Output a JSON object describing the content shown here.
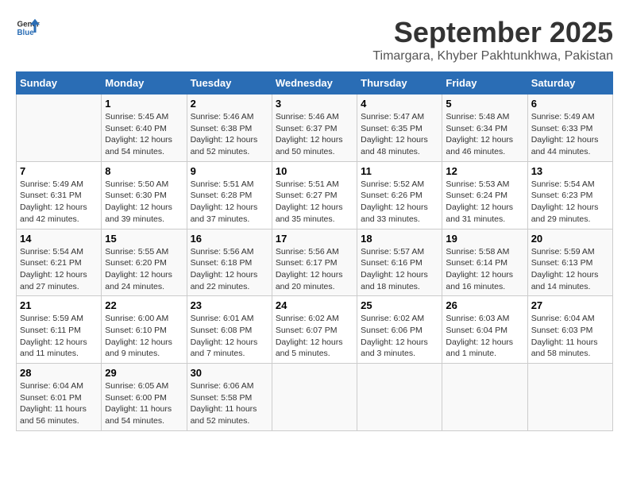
{
  "header": {
    "logo_general": "General",
    "logo_blue": "Blue",
    "month_title": "September 2025",
    "subtitle": "Timargara, Khyber Pakhtunkhwa, Pakistan"
  },
  "days_of_week": [
    "Sunday",
    "Monday",
    "Tuesday",
    "Wednesday",
    "Thursday",
    "Friday",
    "Saturday"
  ],
  "weeks": [
    [
      {
        "day": "",
        "sunrise": "",
        "sunset": "",
        "daylight": ""
      },
      {
        "day": "1",
        "sunrise": "Sunrise: 5:45 AM",
        "sunset": "Sunset: 6:40 PM",
        "daylight": "Daylight: 12 hours and 54 minutes."
      },
      {
        "day": "2",
        "sunrise": "Sunrise: 5:46 AM",
        "sunset": "Sunset: 6:38 PM",
        "daylight": "Daylight: 12 hours and 52 minutes."
      },
      {
        "day": "3",
        "sunrise": "Sunrise: 5:46 AM",
        "sunset": "Sunset: 6:37 PM",
        "daylight": "Daylight: 12 hours and 50 minutes."
      },
      {
        "day": "4",
        "sunrise": "Sunrise: 5:47 AM",
        "sunset": "Sunset: 6:35 PM",
        "daylight": "Daylight: 12 hours and 48 minutes."
      },
      {
        "day": "5",
        "sunrise": "Sunrise: 5:48 AM",
        "sunset": "Sunset: 6:34 PM",
        "daylight": "Daylight: 12 hours and 46 minutes."
      },
      {
        "day": "6",
        "sunrise": "Sunrise: 5:49 AM",
        "sunset": "Sunset: 6:33 PM",
        "daylight": "Daylight: 12 hours and 44 minutes."
      }
    ],
    [
      {
        "day": "7",
        "sunrise": "Sunrise: 5:49 AM",
        "sunset": "Sunset: 6:31 PM",
        "daylight": "Daylight: 12 hours and 42 minutes."
      },
      {
        "day": "8",
        "sunrise": "Sunrise: 5:50 AM",
        "sunset": "Sunset: 6:30 PM",
        "daylight": "Daylight: 12 hours and 39 minutes."
      },
      {
        "day": "9",
        "sunrise": "Sunrise: 5:51 AM",
        "sunset": "Sunset: 6:28 PM",
        "daylight": "Daylight: 12 hours and 37 minutes."
      },
      {
        "day": "10",
        "sunrise": "Sunrise: 5:51 AM",
        "sunset": "Sunset: 6:27 PM",
        "daylight": "Daylight: 12 hours and 35 minutes."
      },
      {
        "day": "11",
        "sunrise": "Sunrise: 5:52 AM",
        "sunset": "Sunset: 6:26 PM",
        "daylight": "Daylight: 12 hours and 33 minutes."
      },
      {
        "day": "12",
        "sunrise": "Sunrise: 5:53 AM",
        "sunset": "Sunset: 6:24 PM",
        "daylight": "Daylight: 12 hours and 31 minutes."
      },
      {
        "day": "13",
        "sunrise": "Sunrise: 5:54 AM",
        "sunset": "Sunset: 6:23 PM",
        "daylight": "Daylight: 12 hours and 29 minutes."
      }
    ],
    [
      {
        "day": "14",
        "sunrise": "Sunrise: 5:54 AM",
        "sunset": "Sunset: 6:21 PM",
        "daylight": "Daylight: 12 hours and 27 minutes."
      },
      {
        "day": "15",
        "sunrise": "Sunrise: 5:55 AM",
        "sunset": "Sunset: 6:20 PM",
        "daylight": "Daylight: 12 hours and 24 minutes."
      },
      {
        "day": "16",
        "sunrise": "Sunrise: 5:56 AM",
        "sunset": "Sunset: 6:18 PM",
        "daylight": "Daylight: 12 hours and 22 minutes."
      },
      {
        "day": "17",
        "sunrise": "Sunrise: 5:56 AM",
        "sunset": "Sunset: 6:17 PM",
        "daylight": "Daylight: 12 hours and 20 minutes."
      },
      {
        "day": "18",
        "sunrise": "Sunrise: 5:57 AM",
        "sunset": "Sunset: 6:16 PM",
        "daylight": "Daylight: 12 hours and 18 minutes."
      },
      {
        "day": "19",
        "sunrise": "Sunrise: 5:58 AM",
        "sunset": "Sunset: 6:14 PM",
        "daylight": "Daylight: 12 hours and 16 minutes."
      },
      {
        "day": "20",
        "sunrise": "Sunrise: 5:59 AM",
        "sunset": "Sunset: 6:13 PM",
        "daylight": "Daylight: 12 hours and 14 minutes."
      }
    ],
    [
      {
        "day": "21",
        "sunrise": "Sunrise: 5:59 AM",
        "sunset": "Sunset: 6:11 PM",
        "daylight": "Daylight: 12 hours and 11 minutes."
      },
      {
        "day": "22",
        "sunrise": "Sunrise: 6:00 AM",
        "sunset": "Sunset: 6:10 PM",
        "daylight": "Daylight: 12 hours and 9 minutes."
      },
      {
        "day": "23",
        "sunrise": "Sunrise: 6:01 AM",
        "sunset": "Sunset: 6:08 PM",
        "daylight": "Daylight: 12 hours and 7 minutes."
      },
      {
        "day": "24",
        "sunrise": "Sunrise: 6:02 AM",
        "sunset": "Sunset: 6:07 PM",
        "daylight": "Daylight: 12 hours and 5 minutes."
      },
      {
        "day": "25",
        "sunrise": "Sunrise: 6:02 AM",
        "sunset": "Sunset: 6:06 PM",
        "daylight": "Daylight: 12 hours and 3 minutes."
      },
      {
        "day": "26",
        "sunrise": "Sunrise: 6:03 AM",
        "sunset": "Sunset: 6:04 PM",
        "daylight": "Daylight: 12 hours and 1 minute."
      },
      {
        "day": "27",
        "sunrise": "Sunrise: 6:04 AM",
        "sunset": "Sunset: 6:03 PM",
        "daylight": "Daylight: 11 hours and 58 minutes."
      }
    ],
    [
      {
        "day": "28",
        "sunrise": "Sunrise: 6:04 AM",
        "sunset": "Sunset: 6:01 PM",
        "daylight": "Daylight: 11 hours and 56 minutes."
      },
      {
        "day": "29",
        "sunrise": "Sunrise: 6:05 AM",
        "sunset": "Sunset: 6:00 PM",
        "daylight": "Daylight: 11 hours and 54 minutes."
      },
      {
        "day": "30",
        "sunrise": "Sunrise: 6:06 AM",
        "sunset": "Sunset: 5:58 PM",
        "daylight": "Daylight: 11 hours and 52 minutes."
      },
      {
        "day": "",
        "sunrise": "",
        "sunset": "",
        "daylight": ""
      },
      {
        "day": "",
        "sunrise": "",
        "sunset": "",
        "daylight": ""
      },
      {
        "day": "",
        "sunrise": "",
        "sunset": "",
        "daylight": ""
      },
      {
        "day": "",
        "sunrise": "",
        "sunset": "",
        "daylight": ""
      }
    ]
  ]
}
